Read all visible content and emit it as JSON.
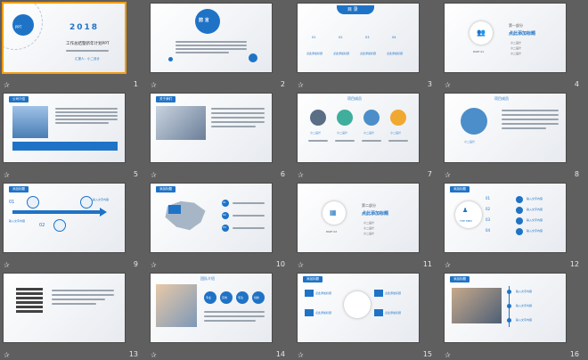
{
  "slides": [
    {
      "num": "1",
      "title": "2018",
      "sub": "工作总结暨新年计划PPT",
      "line": "汇报人：小二设计",
      "logo": "PPT"
    },
    {
      "num": "2",
      "title": "前 言"
    },
    {
      "num": "3",
      "title": "目 录",
      "items": [
        "01",
        "02",
        "03",
        "04"
      ],
      "link": "点此添加标题"
    },
    {
      "num": "4",
      "part": "第一部分",
      "title": "点此添加标题",
      "code": "PART 01",
      "bullets": [
        "小二设计",
        "小二设计",
        "小二设计"
      ]
    },
    {
      "num": "5",
      "tag": "公司介绍"
    },
    {
      "num": "6",
      "tag": "关于我们"
    },
    {
      "num": "7",
      "title": "项目成员",
      "names": [
        "小二设计",
        "小二设计",
        "小二设计",
        "小二设计"
      ]
    },
    {
      "num": "8",
      "title": "项目成员",
      "name": "小二设计"
    },
    {
      "num": "9",
      "tag": "添加标题",
      "labels": [
        "输入文字内容",
        "输入文字内容"
      ],
      "steps": [
        "01",
        "02"
      ]
    },
    {
      "num": "10",
      "tag": "添加标题",
      "steps": [
        "01",
        "02",
        "03"
      ]
    },
    {
      "num": "11",
      "part": "第二部分",
      "title": "点此添加标题",
      "code": "PART 02",
      "bullets": [
        "小二设计",
        "小二设计",
        "小二设计"
      ]
    },
    {
      "num": "12",
      "tag": "添加标题",
      "center": "THE MEN",
      "steps": [
        "01",
        "02",
        "03",
        "04"
      ],
      "labels": [
        "输入文字内容",
        "输入文字内容",
        "输入文字内容",
        "输入文字内容"
      ]
    },
    {
      "num": "13"
    },
    {
      "num": "14",
      "title": "团队介绍",
      "chips": [
        "专业",
        "高效",
        "专注",
        "创新"
      ]
    },
    {
      "num": "15",
      "tag": "添加标题",
      "links": [
        "点此添加标题",
        "点此添加标题",
        "点此添加标题",
        "点此添加标题"
      ]
    },
    {
      "num": "16",
      "tag": "添加标题",
      "labels": [
        "输入文字内容",
        "输入文字内容",
        "输入文字内容"
      ]
    }
  ],
  "colors": {
    "accent": "#1f73c6",
    "bg": "#5f5f5f",
    "selected": "#f39c12"
  },
  "icons": {
    "star": "star-icon"
  }
}
